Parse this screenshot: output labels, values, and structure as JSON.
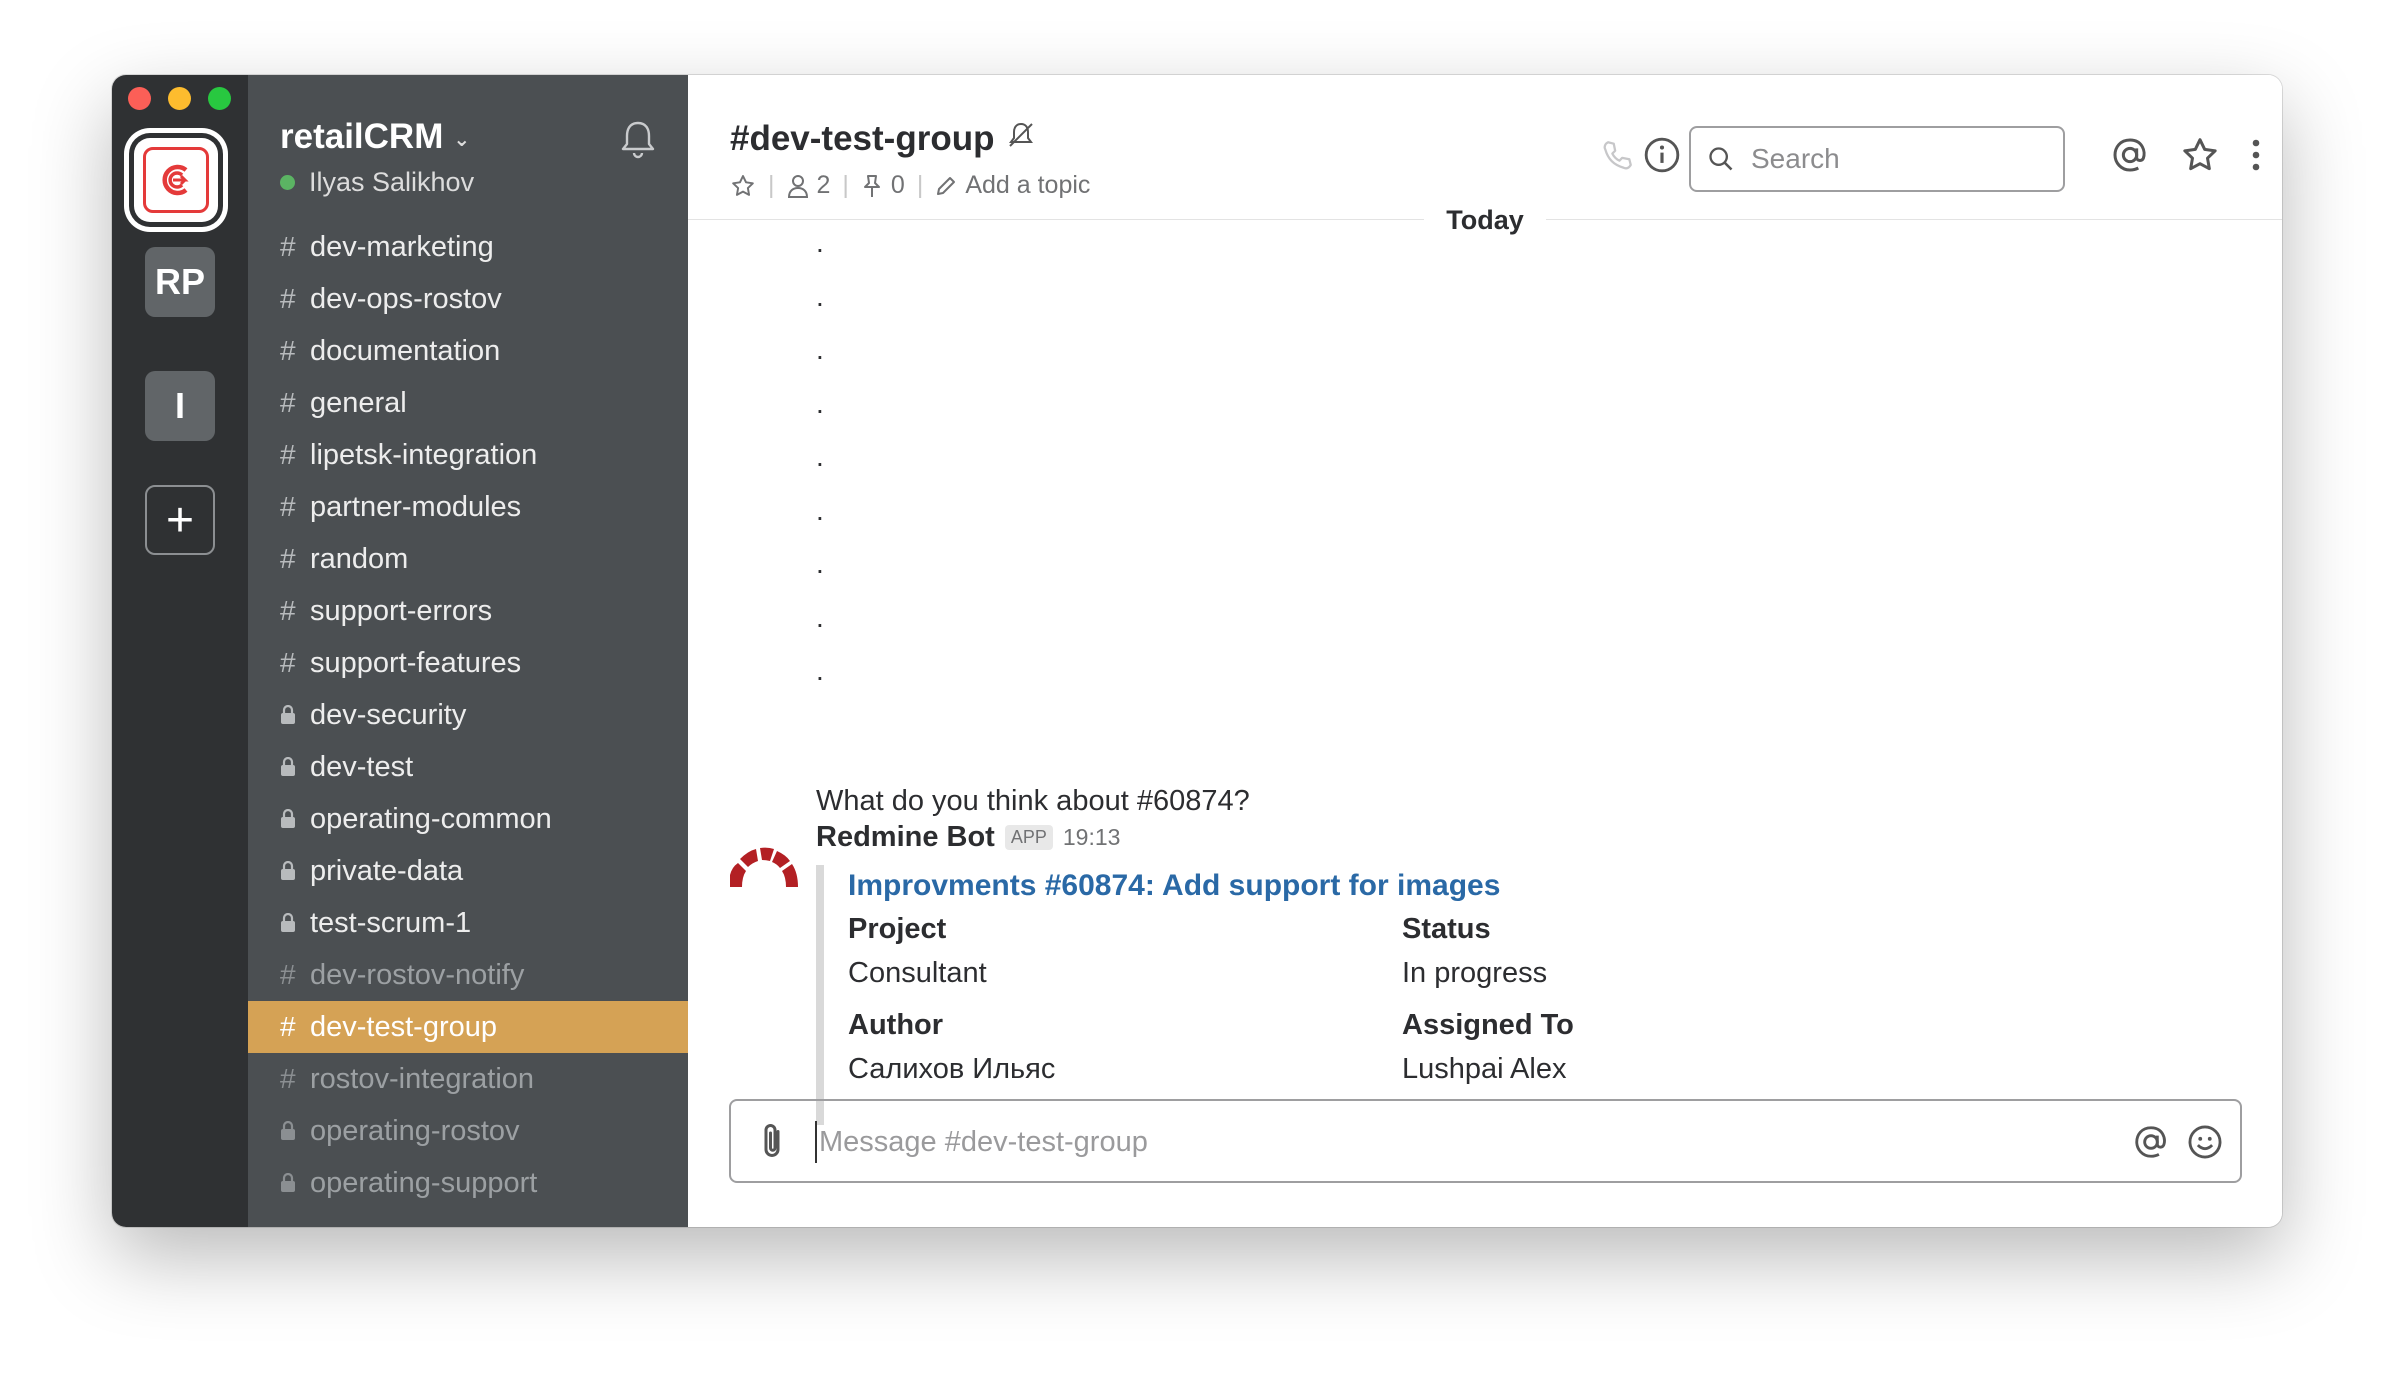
{
  "workspaces": [
    {
      "label": ""
    },
    {
      "label": "RP"
    },
    {
      "label": "I"
    },
    {
      "label": "+"
    }
  ],
  "sidebar": {
    "team_name": "retailCRM",
    "user_name": "Ilyas Salikhov",
    "user_status_color": "#5bb463",
    "channels": [
      {
        "name": "dev-marketing",
        "type": "public",
        "muted": false,
        "active": false
      },
      {
        "name": "dev-ops-rostov",
        "type": "public",
        "muted": false,
        "active": false
      },
      {
        "name": "documentation",
        "type": "public",
        "muted": false,
        "active": false
      },
      {
        "name": "general",
        "type": "public",
        "muted": false,
        "active": false
      },
      {
        "name": "lipetsk-integration",
        "type": "public",
        "muted": false,
        "active": false
      },
      {
        "name": "partner-modules",
        "type": "public",
        "muted": false,
        "active": false
      },
      {
        "name": "random",
        "type": "public",
        "muted": false,
        "active": false
      },
      {
        "name": "support-errors",
        "type": "public",
        "muted": false,
        "active": false
      },
      {
        "name": "support-features",
        "type": "public",
        "muted": false,
        "active": false
      },
      {
        "name": "dev-security",
        "type": "private",
        "muted": false,
        "active": false
      },
      {
        "name": "dev-test",
        "type": "private",
        "muted": false,
        "active": false
      },
      {
        "name": "operating-common",
        "type": "private",
        "muted": false,
        "active": false
      },
      {
        "name": "private-data",
        "type": "private",
        "muted": false,
        "active": false
      },
      {
        "name": "test-scrum-1",
        "type": "private",
        "muted": false,
        "active": false
      },
      {
        "name": "dev-rostov-notify",
        "type": "public",
        "muted": true,
        "active": false
      },
      {
        "name": "dev-test-group",
        "type": "public",
        "muted": false,
        "active": true
      },
      {
        "name": "rostov-integration",
        "type": "public",
        "muted": true,
        "active": false
      },
      {
        "name": "operating-rostov",
        "type": "private",
        "muted": true,
        "active": false
      },
      {
        "name": "operating-support",
        "type": "private",
        "muted": true,
        "active": false
      }
    ],
    "accent_color": "#d5a255"
  },
  "header": {
    "channel_title": "#dev-test-group",
    "members_count": "2",
    "pins_count": "0",
    "topic_placeholder": "Add a topic",
    "search_placeholder": "Search"
  },
  "messages": {
    "divider_label": "Today",
    "dots": [
      ".",
      ".",
      ".",
      ".",
      ".",
      ".",
      ".",
      ".",
      "."
    ],
    "user_text": "What do you think about #60874?",
    "bot": {
      "name": "Redmine Bot",
      "badge": "APP",
      "time": "19:13",
      "attachment_title": "Improvments #60874: Add support for images",
      "fields": {
        "project_label": "Project",
        "project_value": "Consultant",
        "status_label": "Status",
        "status_value": "In progress",
        "author_label": "Author",
        "author_value": "Салихов Ильяс",
        "assignee_label": "Assigned To",
        "assignee_value": "Lushpai Alex"
      }
    }
  },
  "composer": {
    "placeholder": "Message #dev-test-group"
  }
}
